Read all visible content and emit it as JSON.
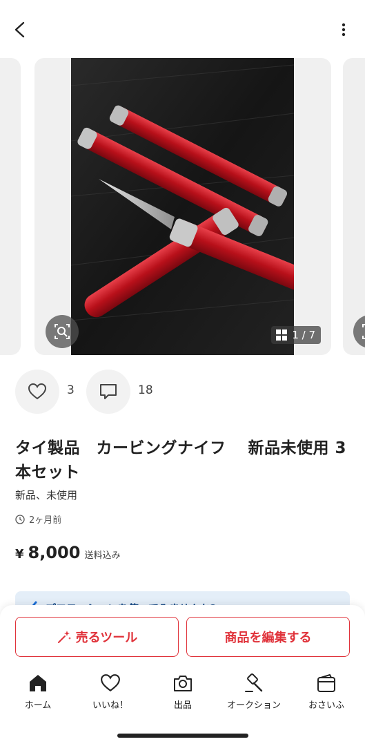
{
  "header": {
    "back_icon": "chevron-left-icon",
    "more_icon": "more-vertical-icon"
  },
  "gallery": {
    "counter_text": "1 / 7",
    "zoom_icon": "image-search-icon",
    "grid_icon": "grid-icon",
    "photo_description_colors": {
      "handle": "#c8141e",
      "table": "#1c1c1c",
      "blade": "#c9c9c9"
    }
  },
  "social": {
    "likes": "3",
    "comments": "18"
  },
  "item": {
    "title": "タイ製品　カービングナイフ　 新品未使用 3本セット",
    "condition": "新品、未使用",
    "posted": "2ヶ月前",
    "price_currency": "¥",
    "price_amount": "8,000",
    "price_note": "送料込み"
  },
  "promo": {
    "text": "プロモーションを使ってみませんか?"
  },
  "actions": {
    "sell_tool_label": "売るツール",
    "edit_label": "商品を編集する"
  },
  "tabs": [
    {
      "label": "ホーム",
      "icon": "home-icon"
    },
    {
      "label": "いいね！",
      "icon": "heart-icon"
    },
    {
      "label": "出品",
      "icon": "camera-icon"
    },
    {
      "label": "オークション",
      "icon": "gavel-icon"
    },
    {
      "label": "おさいふ",
      "icon": "wallet-icon"
    }
  ],
  "colors": {
    "accent_red": "#e0323a",
    "promo_bg": "#e4eef8"
  }
}
